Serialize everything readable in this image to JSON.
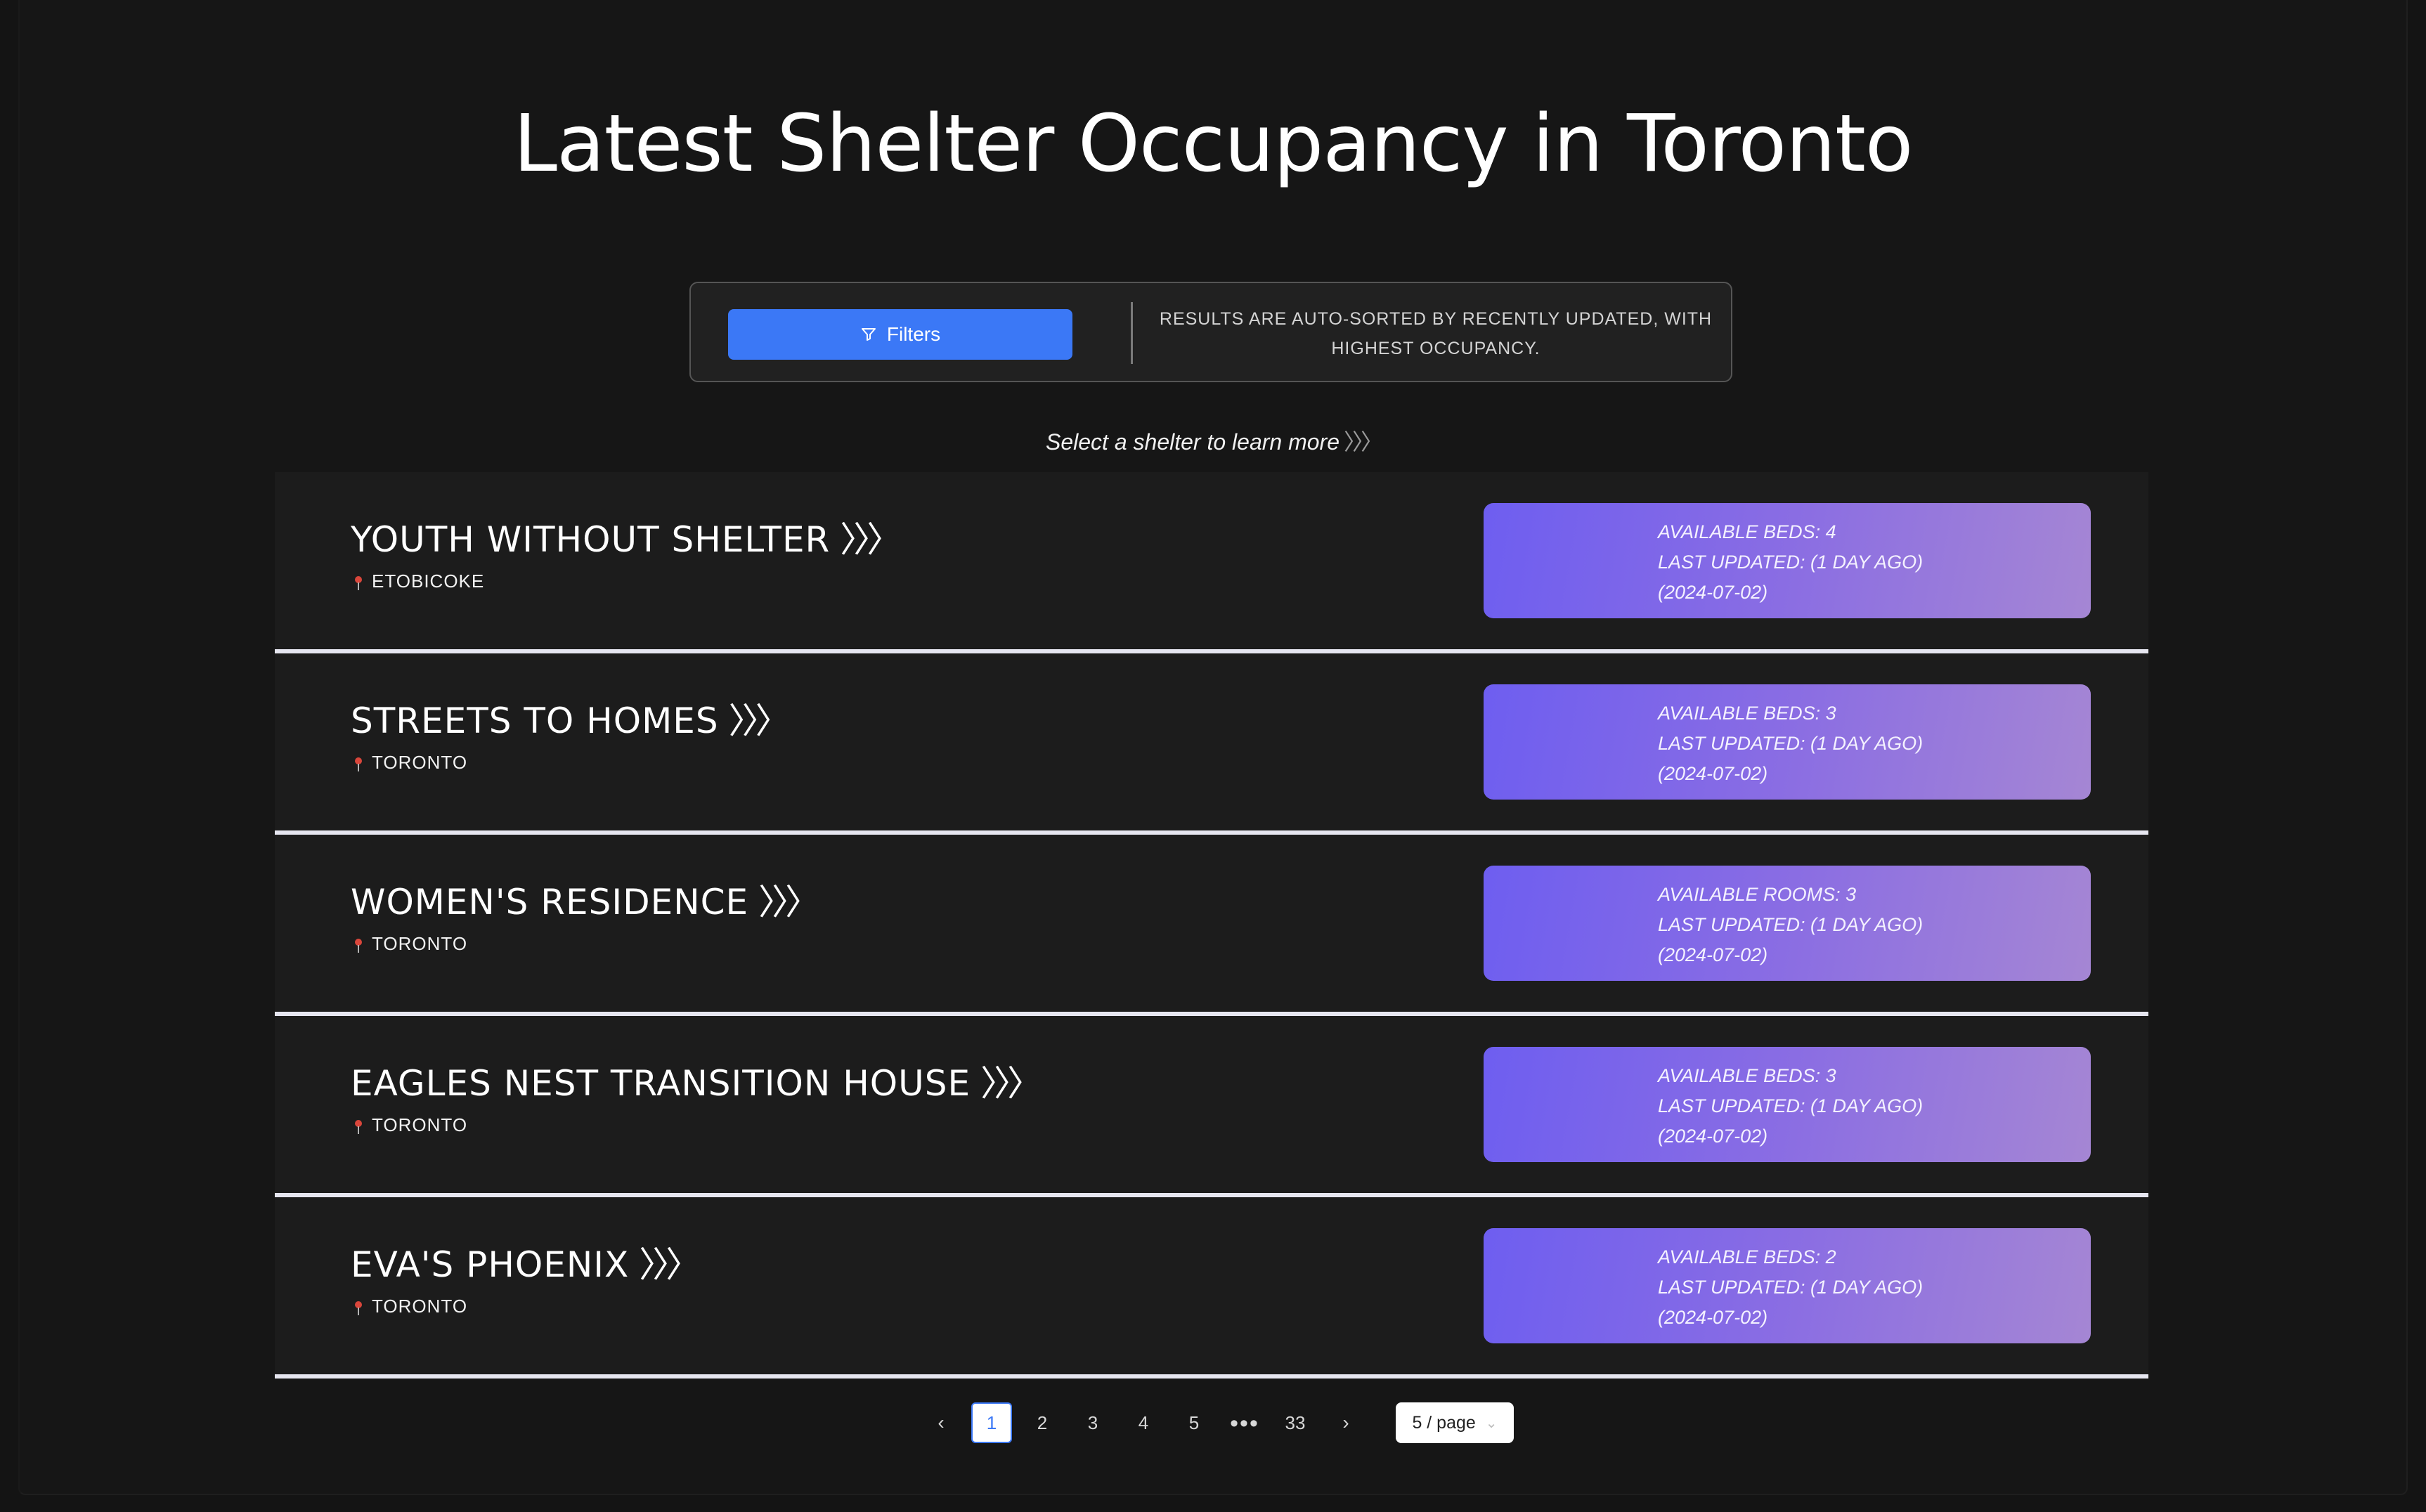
{
  "page_title": "Latest Shelter Occupancy in Toronto",
  "toolbar": {
    "filters_label": "Filters",
    "sort_note": "RESULTS ARE AUTO-SORTED BY RECENTLY UPDATED, WITH HIGHEST OCCUPANCY."
  },
  "hint": {
    "text": "Select a shelter to learn more",
    "chevrons": "〉〉〉"
  },
  "shelters": [
    {
      "name": "YOUTH WITHOUT SHELTER",
      "arrows": "〉〉〉",
      "location": "ETOBICOKE",
      "availability": "AVAILABLE BEDS: 4",
      "updated": "LAST UPDATED: (1 DAY AGO)",
      "date": "(2024-07-02)"
    },
    {
      "name": "STREETS TO HOMES",
      "arrows": "〉〉〉",
      "location": "TORONTO",
      "availability": "AVAILABLE BEDS: 3",
      "updated": "LAST UPDATED: (1 DAY AGO)",
      "date": "(2024-07-02)"
    },
    {
      "name": "WOMEN'S RESIDENCE",
      "arrows": "〉〉〉",
      "location": "TORONTO",
      "availability": "AVAILABLE ROOMS: 3",
      "updated": "LAST UPDATED: (1 DAY AGO)",
      "date": "(2024-07-02)"
    },
    {
      "name": "EAGLES NEST TRANSITION HOUSE",
      "arrows": "〉〉〉",
      "location": "TORONTO",
      "availability": "AVAILABLE BEDS: 3",
      "updated": "LAST UPDATED: (1 DAY AGO)",
      "date": "(2024-07-02)"
    },
    {
      "name": "EVA'S PHOENIX",
      "arrows": "〉〉〉",
      "location": "TORONTO",
      "availability": "AVAILABLE BEDS: 2",
      "updated": "LAST UPDATED: (1 DAY AGO)",
      "date": "(2024-07-02)"
    }
  ],
  "pagination": {
    "prev": "‹",
    "pages": [
      "1",
      "2",
      "3",
      "4",
      "5"
    ],
    "ellipsis": "•••",
    "last": "33",
    "next": "›",
    "active_page": "1",
    "page_size": "5 / page"
  },
  "colors": {
    "accent": "#3b78f6",
    "badge_gradient_start": "#6e5ef0",
    "badge_gradient_end": "#a586d4",
    "pin": "#d9463b"
  },
  "icons": {
    "filter": "funnel-icon",
    "location": "map-pin-icon"
  }
}
